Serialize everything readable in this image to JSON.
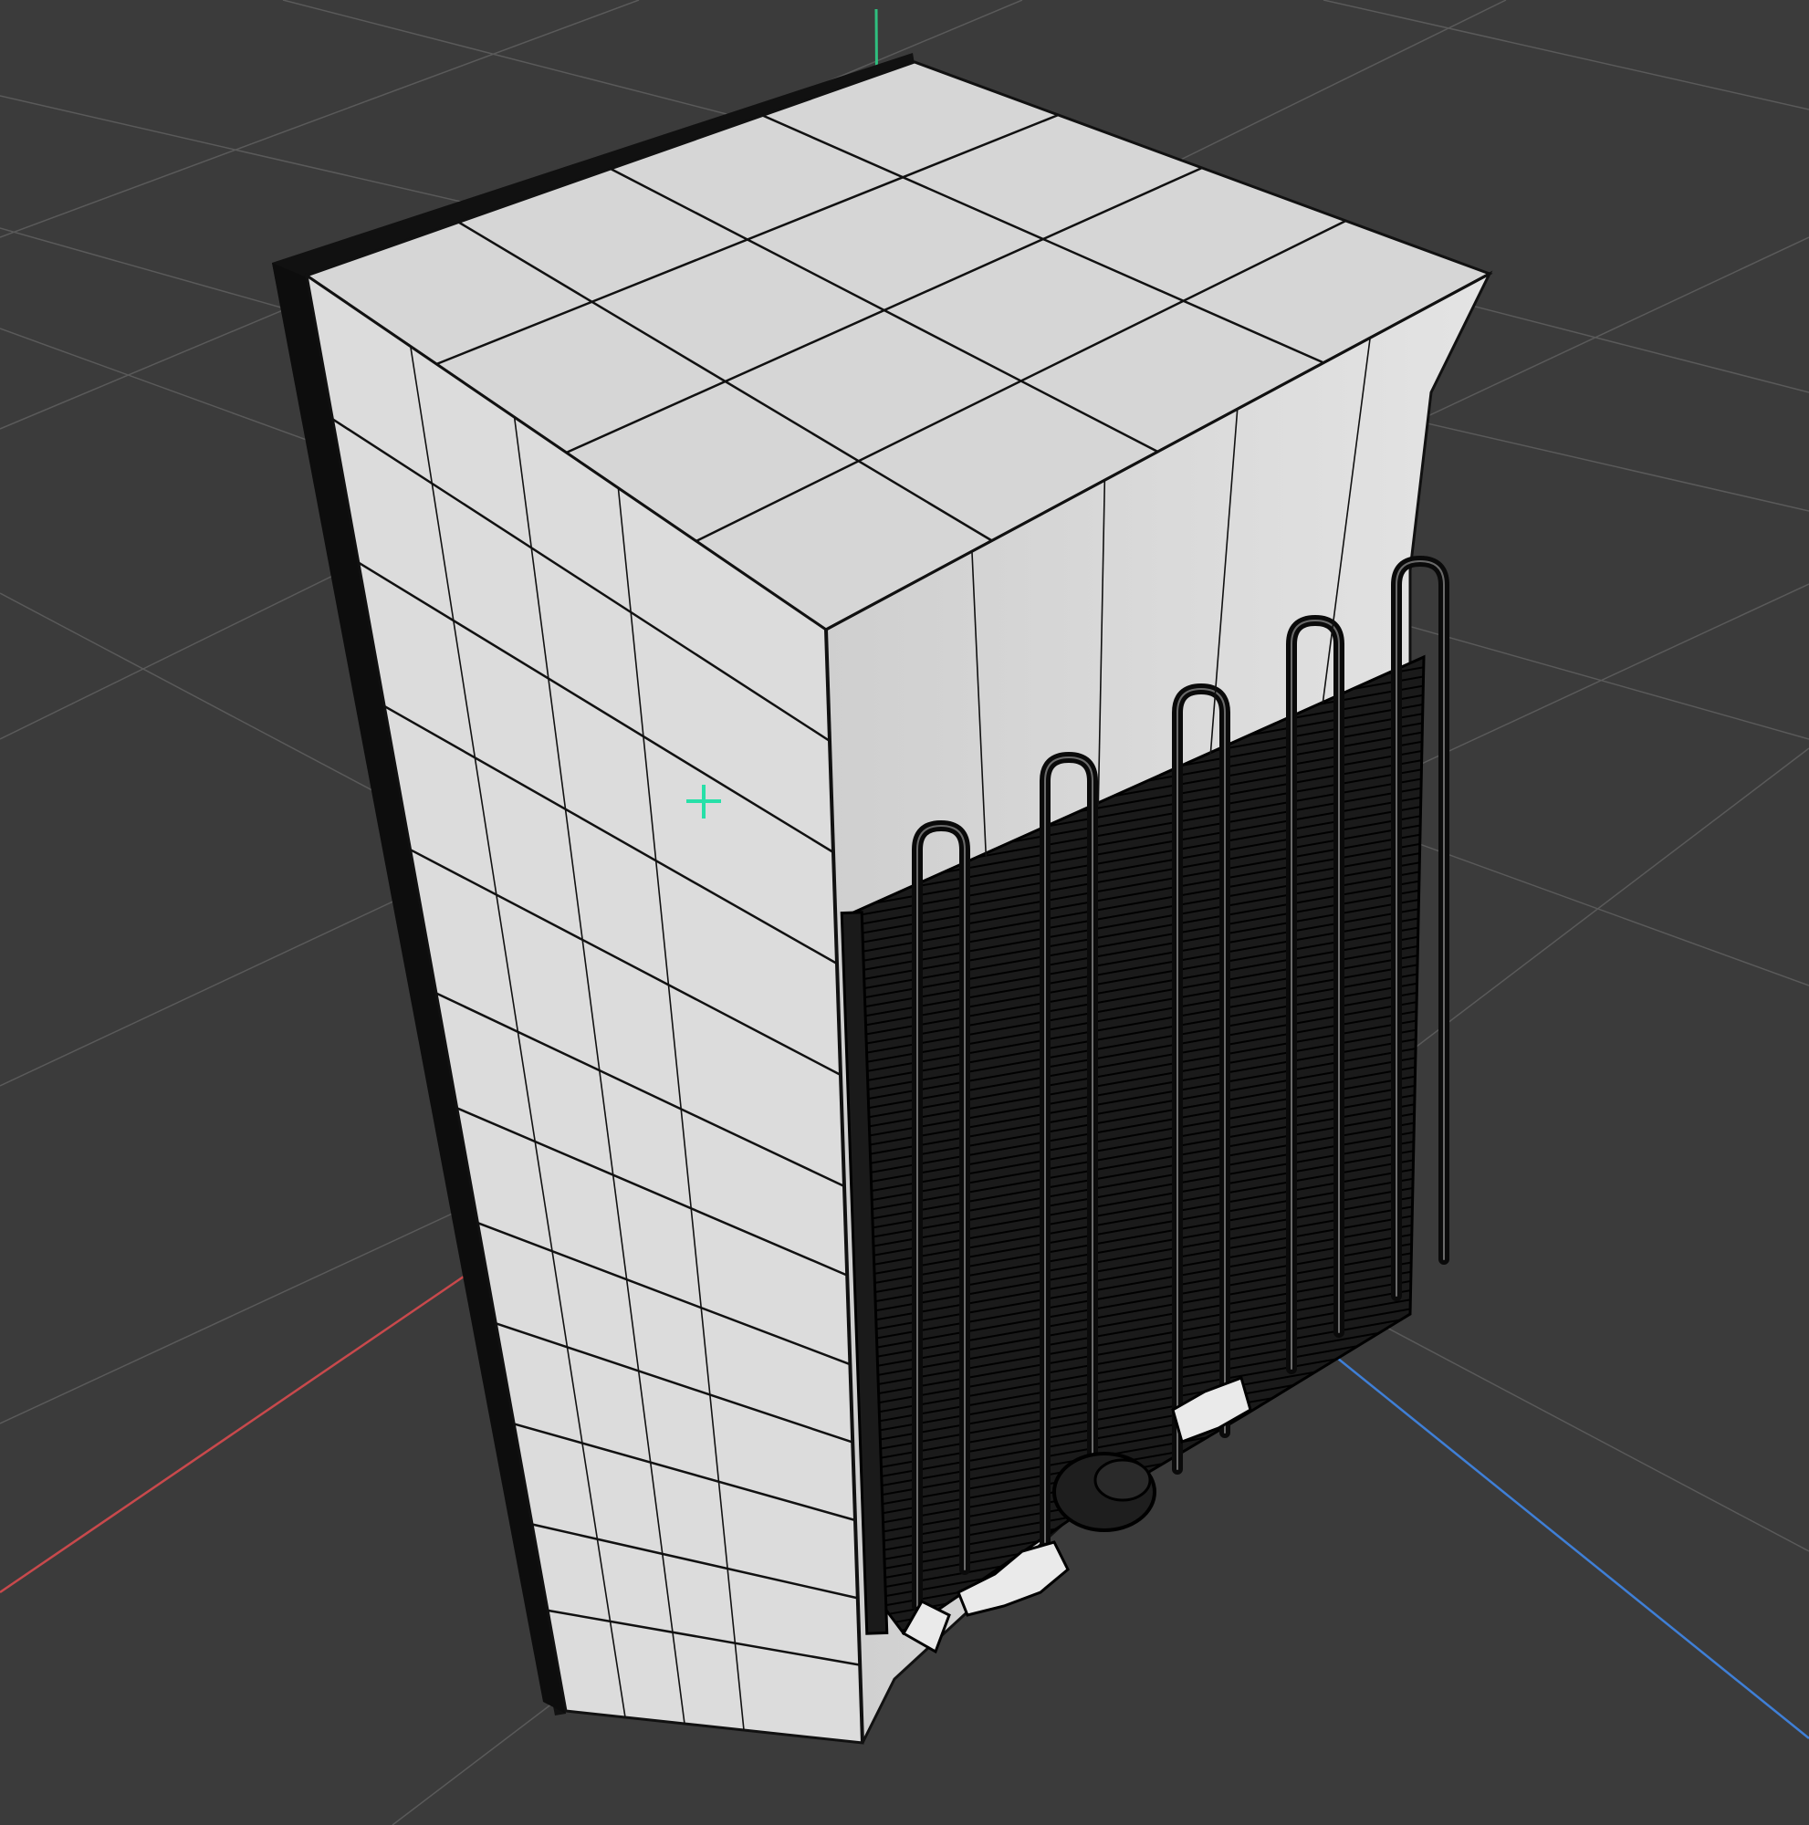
{
  "viewport": {
    "background": "#3b3b3b",
    "grid_color": "#5a5a5a",
    "axes": {
      "x_color": "#c8494c",
      "y_color": "#2fbf7f",
      "z_color": "#3f7fd6"
    },
    "pivot_color": "#27e0a8",
    "model": {
      "name": "refrigerator",
      "display": "shaded-wireframe",
      "surface_color": "#d9d9d9",
      "edge_color": "#111111",
      "coil_color": "#0a0a0a"
    }
  }
}
